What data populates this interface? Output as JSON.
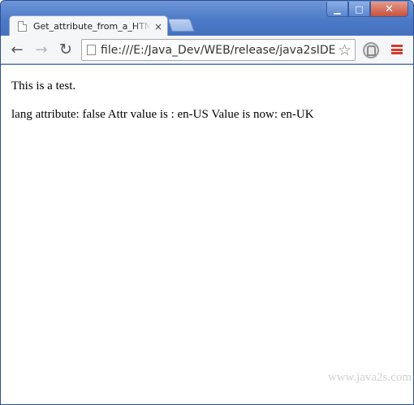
{
  "tab": {
    "title": "Get_attribute_from_a_HTML",
    "close": "×"
  },
  "window_controls": {
    "minimize": "▁",
    "maximize": "□",
    "close": "✕"
  },
  "toolbar": {
    "back": "←",
    "forward": "→",
    "reload": "↻",
    "url": "file:///E:/Java_Dev/WEB/release/java2sIDE",
    "star": "☆"
  },
  "page": {
    "line1": "This is a test.",
    "line2": "lang attribute: false Attr value is : en-US Value is now: en-UK"
  },
  "watermark": "www.java2s.com"
}
